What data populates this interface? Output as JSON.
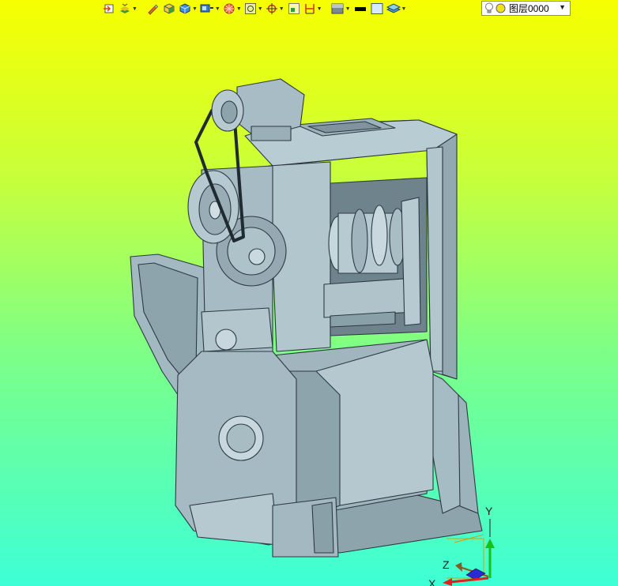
{
  "viewport": {
    "gradient_top": "#f7ff00",
    "gradient_bottom": "#3dffd6"
  },
  "toolbar": {
    "buttons": [
      {
        "icon": "import-icon",
        "dropdown": false
      },
      {
        "icon": "layers-stack-icon",
        "dropdown": true
      },
      {
        "icon": "pencil-icon",
        "dropdown": false
      },
      {
        "icon": "cube-shaded-icon",
        "dropdown": false
      },
      {
        "icon": "cube-view-icon",
        "dropdown": true
      },
      {
        "icon": "view-orient-icon",
        "dropdown": true
      },
      {
        "icon": "sphere-render-icon",
        "dropdown": true
      },
      {
        "icon": "frame-select-icon",
        "dropdown": true
      },
      {
        "icon": "snap-target-icon",
        "dropdown": true
      },
      {
        "icon": "grid-window-icon",
        "dropdown": false
      },
      {
        "icon": "dimension-icon",
        "dropdown": true
      },
      {
        "icon": "material-icon",
        "dropdown": true
      },
      {
        "icon": "line-color-icon",
        "dropdown": false
      },
      {
        "icon": "fill-color-icon",
        "dropdown": false
      },
      {
        "icon": "layer-display-icon",
        "dropdown": true
      }
    ]
  },
  "layer_select": {
    "value": "图层0000",
    "icons": [
      "lightbulb-icon",
      "layer-color-icon"
    ]
  },
  "triad": {
    "y_label": "Y",
    "z_label": "Z",
    "x_label": "X",
    "y_color": "#18c01a",
    "z_color": "#2a2ad8",
    "x_color": "#e02020"
  }
}
